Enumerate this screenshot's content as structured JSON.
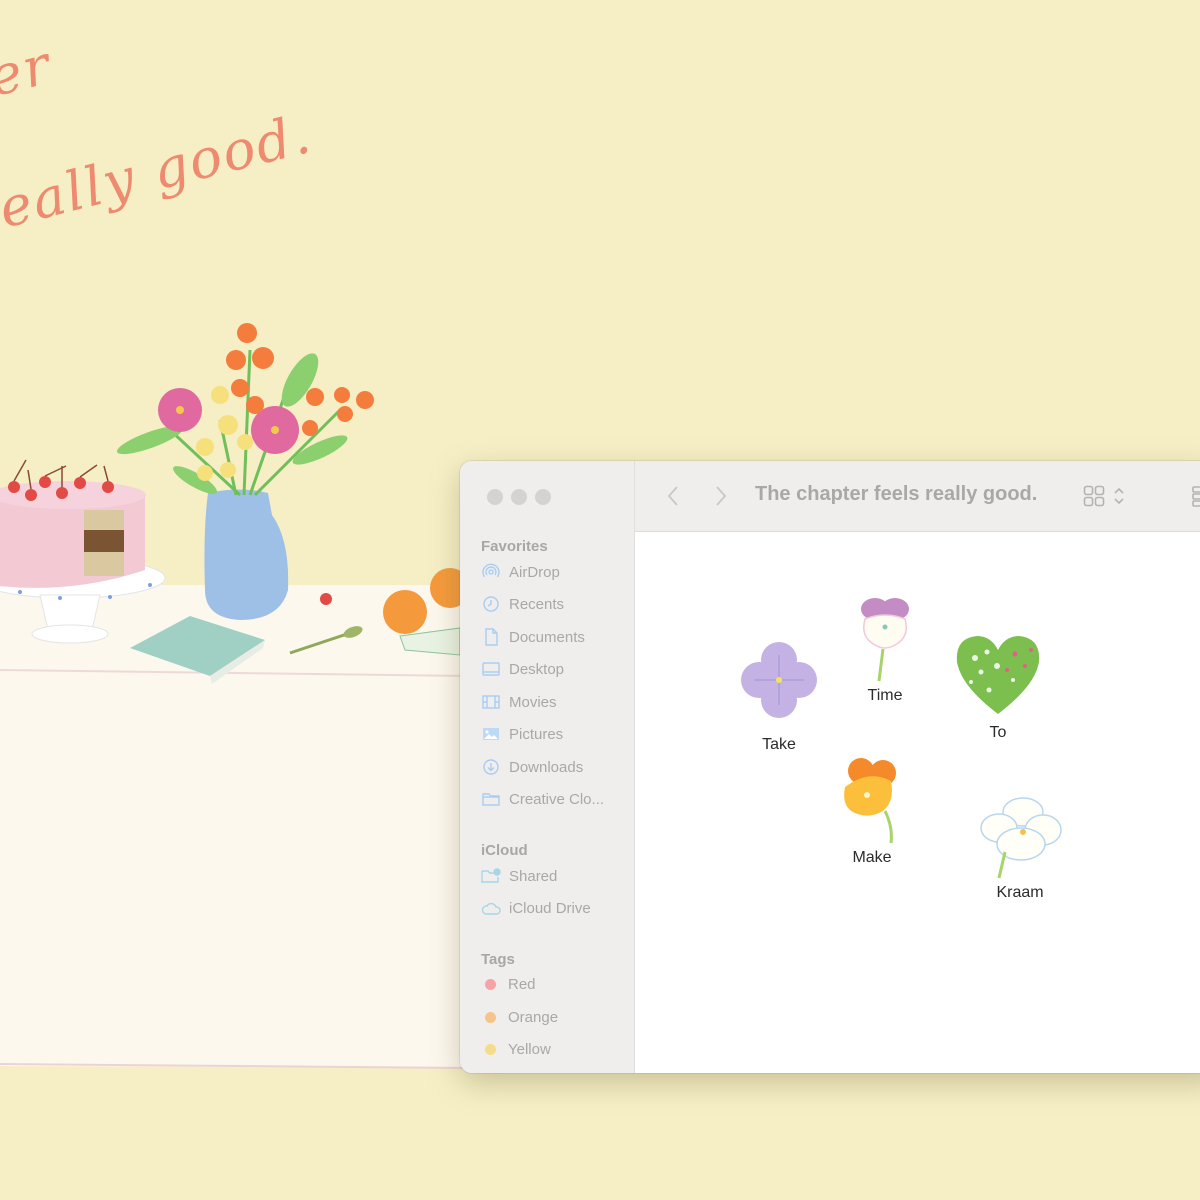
{
  "wallpaper": {
    "handwriting_line1": "er",
    "handwriting_line2": "really good.",
    "background_color": "#f6efc6",
    "text_color": "#ee8a70"
  },
  "window": {
    "title": "The chapter feels really good.",
    "toolbar": {
      "back_icon": "chevron-left-icon",
      "forward_icon": "chevron-right-icon",
      "view_icon": "grid-view-icon",
      "view_toggle_icon": "up-down-chevron-icon",
      "group_icon": "group-icon"
    },
    "sidebar": {
      "favorites_title": "Favorites",
      "favorites": [
        {
          "label": "AirDrop",
          "icon": "airdrop-icon"
        },
        {
          "label": "Recents",
          "icon": "clock-icon"
        },
        {
          "label": "Documents",
          "icon": "document-icon"
        },
        {
          "label": "Desktop",
          "icon": "desktop-icon"
        },
        {
          "label": "Movies",
          "icon": "film-icon"
        },
        {
          "label": "Pictures",
          "icon": "photo-icon"
        },
        {
          "label": "Downloads",
          "icon": "download-icon"
        },
        {
          "label": "Creative Clo...",
          "icon": "folder-icon"
        }
      ],
      "icloud_title": "iCloud",
      "icloud": [
        {
          "label": "Shared",
          "icon": "shared-folder-icon"
        },
        {
          "label": "iCloud Drive",
          "icon": "cloud-icon"
        }
      ],
      "tags_title": "Tags",
      "tags": [
        {
          "label": "Red",
          "color": "#f7a3a6"
        },
        {
          "label": "Orange",
          "color": "#f5c48c"
        },
        {
          "label": "Yellow",
          "color": "#f4dc8a"
        }
      ],
      "icon_color": "#a9cdf2"
    },
    "files": [
      {
        "label": "Take",
        "icon": "purple-flower-icon"
      },
      {
        "label": "Time",
        "icon": "white-pansy-icon"
      },
      {
        "label": "To",
        "icon": "green-heart-icon"
      },
      {
        "label": "Make",
        "icon": "orange-pansy-icon"
      },
      {
        "label": "Kraam",
        "icon": "white-flower-icon"
      }
    ]
  }
}
